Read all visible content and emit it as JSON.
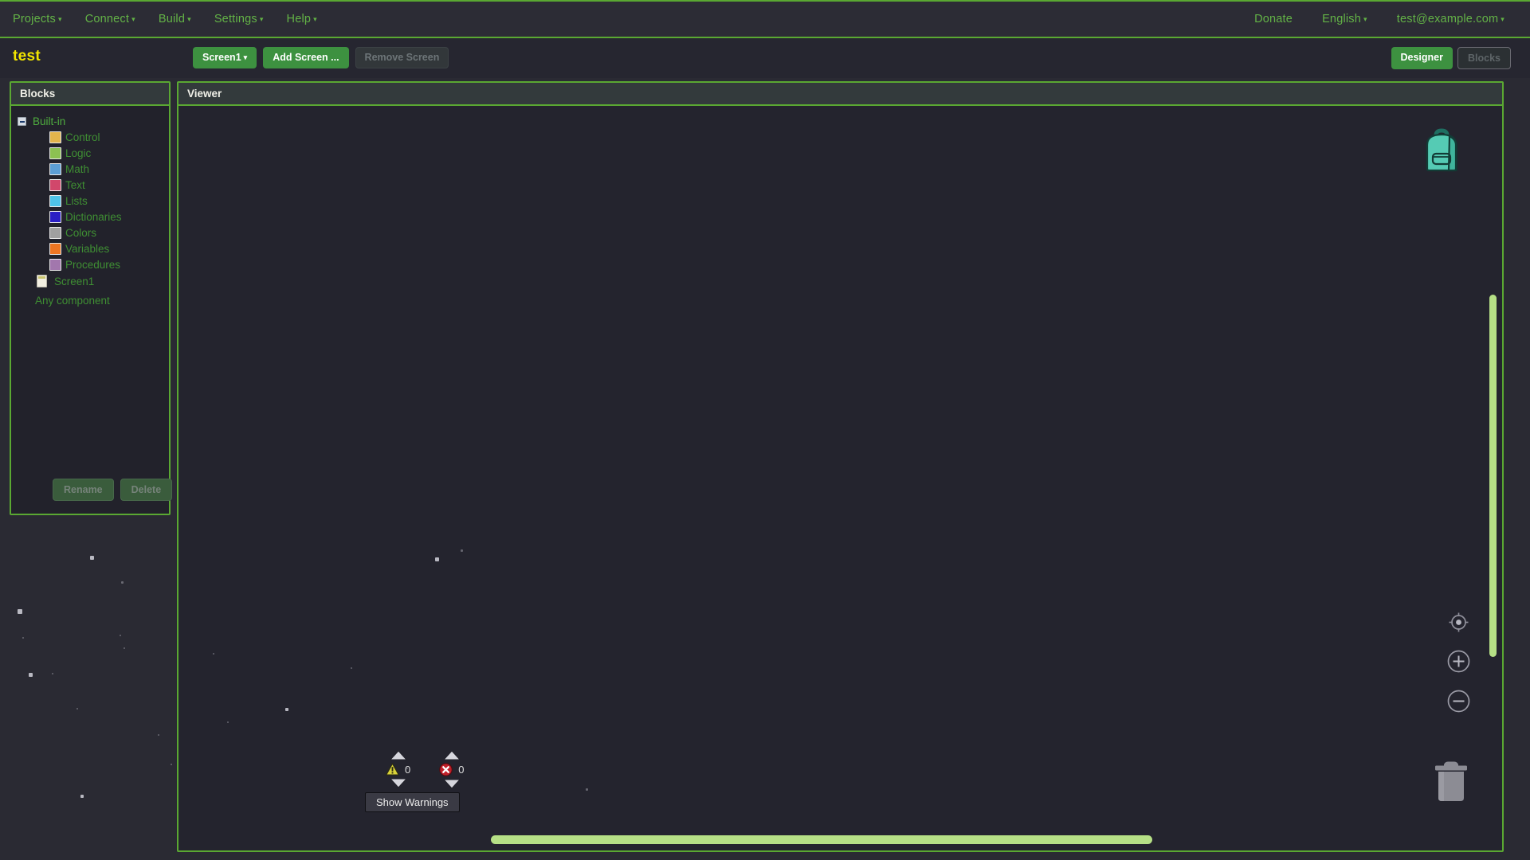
{
  "menu": {
    "left": [
      {
        "label": "Projects",
        "caret": true
      },
      {
        "label": "Connect",
        "caret": true
      },
      {
        "label": "Build",
        "caret": true
      },
      {
        "label": "Settings",
        "caret": true
      },
      {
        "label": "Help",
        "caret": true
      }
    ],
    "right": [
      {
        "label": "Donate",
        "caret": false
      },
      {
        "label": "English",
        "caret": true
      },
      {
        "label": "test@example.com",
        "caret": true
      }
    ],
    "caret_glyph": "▾"
  },
  "project": {
    "title": "test",
    "title_color": "#f2e500",
    "screen_selector": "Screen1",
    "screen_selector_caret": "▾",
    "add_screen": "Add Screen ...",
    "remove_screen": "Remove Screen",
    "remove_screen_enabled": false
  },
  "view_toggle": {
    "designer": "Designer",
    "blocks": "Blocks",
    "active": "Blocks"
  },
  "palette": {
    "header": "Blocks",
    "root": {
      "label": "Built-in",
      "expanded": true
    },
    "categories": [
      {
        "label": "Control",
        "color": "#e3b44c"
      },
      {
        "label": "Logic",
        "color": "#8cc152"
      },
      {
        "label": "Math",
        "color": "#5c9fd6"
      },
      {
        "label": "Text",
        "color": "#d1476b"
      },
      {
        "label": "Lists",
        "color": "#4ec3e8"
      },
      {
        "label": "Dictionaries",
        "color": "#2a1ec4"
      },
      {
        "label": "Colors",
        "color": "#a0a0a0"
      },
      {
        "label": "Variables",
        "color": "#ef7622"
      },
      {
        "label": "Procedures",
        "color": "#a277ad"
      }
    ],
    "screen_node": "Screen1",
    "any_component": "Any component",
    "rename_button": "Rename",
    "delete_button": "Delete",
    "rename_enabled": false,
    "delete_enabled": false
  },
  "viewer": {
    "header": "Viewer",
    "backpack_icon": "backpack-icon",
    "center_icon": "center-blocks-icon",
    "zoom_in_icon": "zoom-in-icon",
    "zoom_out_icon": "zoom-out-icon",
    "trash_icon": "trash-icon"
  },
  "status": {
    "warning_count": "0",
    "error_count": "0",
    "show_warnings_button": "Show Warnings"
  },
  "colors": {
    "accent_green": "#5aa832",
    "button_green": "#3d9140",
    "panel_bg": "#22222b",
    "canvas_bg": "#24242e",
    "header_bg": "#333a3c",
    "scrollbar": "#b6e086",
    "backpack": "#55cbb4"
  }
}
